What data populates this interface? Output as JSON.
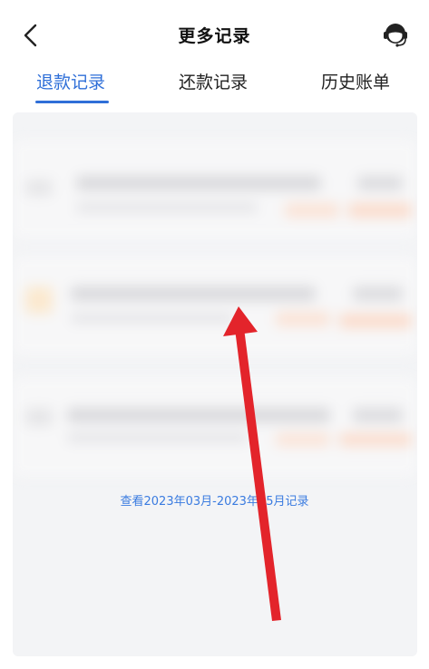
{
  "header": {
    "title": "更多记录",
    "back_icon": "chevron-left-icon",
    "service_icon": "customer-service-icon"
  },
  "tabs": [
    {
      "label": "退款记录",
      "active": true
    },
    {
      "label": "还款记录",
      "active": false
    },
    {
      "label": "历史账单",
      "active": false
    }
  ],
  "content": {
    "more_records_link": "查看2023年03月-2023年05月记录"
  },
  "annotation": {
    "arrow_icon": "red-arrow-icon",
    "color": "#e3242b"
  },
  "colors": {
    "accent": "#2f6fd8",
    "link": "#3a7be0"
  }
}
